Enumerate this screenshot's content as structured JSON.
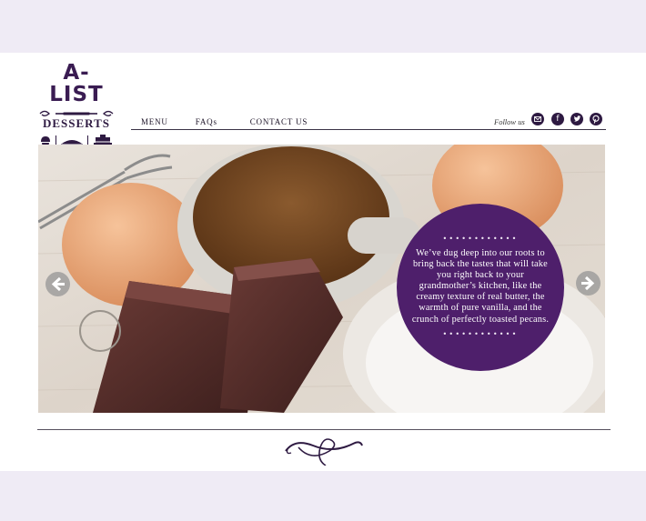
{
  "brand": {
    "logo_title": "A-LIST",
    "logo_subtitle": "DESSERTS"
  },
  "nav": {
    "items": [
      "MENU",
      "FAQs",
      "CONTACT US"
    ]
  },
  "social": {
    "follow_label": "Follow us",
    "icons": [
      "email-icon",
      "facebook-icon",
      "twitter-icon",
      "pinterest-icon"
    ]
  },
  "hero": {
    "message": "We’ve dug deep into our roots to bring back the tastes that will take you right back to your grandmother’s kitchen, like the creamy texture of real butter, the warmth of pure vanilla, and the crunch of perfectly toasted pecans.",
    "dots": "••••••••••••",
    "accent_color": "#4e1f6b"
  },
  "colors": {
    "page_bg": "#efebf5",
    "brand_purple": "#3a1c52"
  }
}
